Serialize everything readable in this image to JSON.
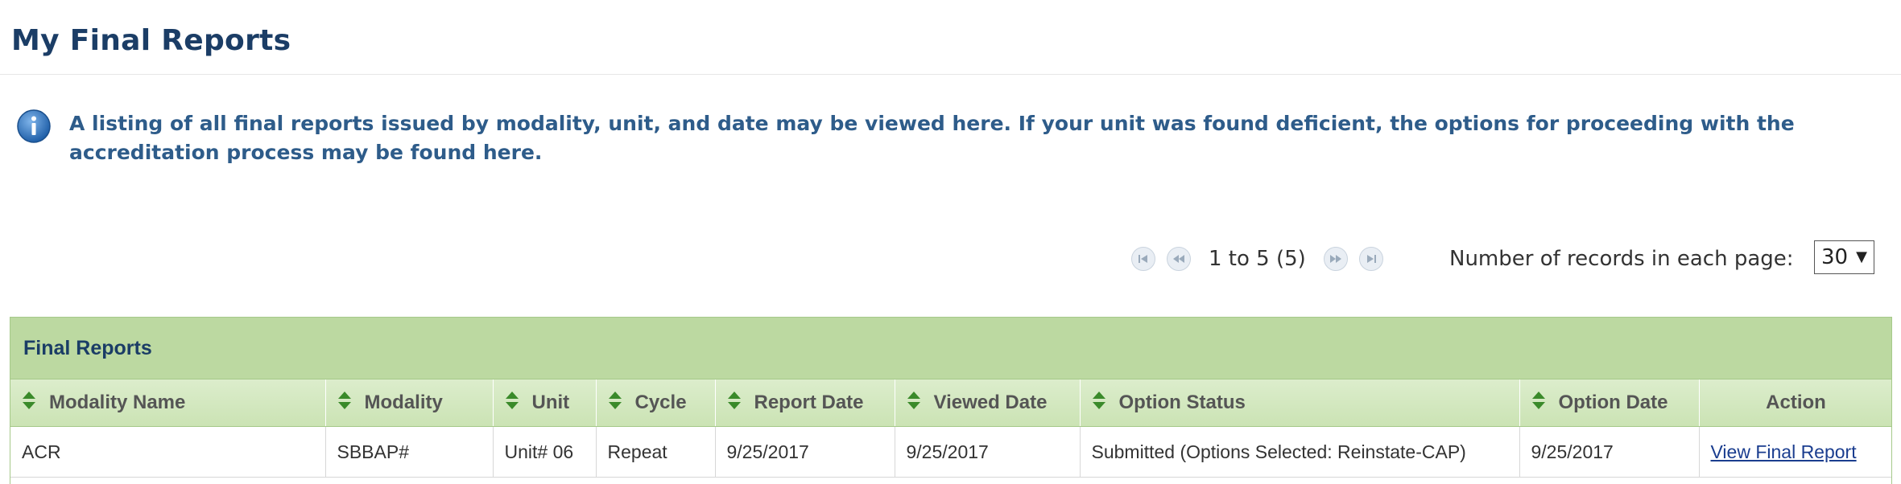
{
  "page": {
    "title": "My Final Reports"
  },
  "info": {
    "icon": "info-icon",
    "text": "A listing of all final reports issued by modality, unit, and date may be viewed here. If your unit was found deficient, the options for proceeding with the accreditation process may be found here."
  },
  "pager": {
    "range_text": "1 to 5 (5)",
    "records_label": "Number of records in each page:",
    "records_value": "30"
  },
  "grid": {
    "caption": "Final Reports",
    "columns": [
      "Modality Name",
      "Modality",
      "Unit",
      "Cycle",
      "Report Date",
      "Viewed Date",
      "Option Status",
      "Option Date",
      "Action"
    ],
    "rows": [
      {
        "modality_name": "ACR",
        "modality": "SBBAP#",
        "unit": "Unit# 06",
        "cycle": "Repeat",
        "report_date": "9/25/2017",
        "viewed_date": "9/25/2017",
        "option_status": "Submitted (Options Selected: Reinstate-CAP)",
        "option_date": "9/25/2017",
        "action": "View Final Report"
      }
    ]
  },
  "colors": {
    "title": "#1b3d66",
    "info_text": "#2e5c8a",
    "grid_header": "#bcd9a1",
    "sort_arrow": "#3a8a2a",
    "link": "#1a3d8f"
  }
}
